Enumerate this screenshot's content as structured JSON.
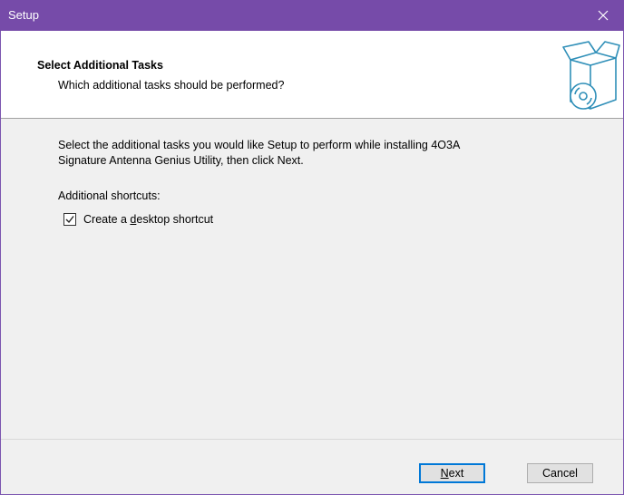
{
  "window": {
    "title": "Setup",
    "close_icon": "close-icon",
    "accent": "#764ba9"
  },
  "header": {
    "title": "Select Additional Tasks",
    "subtitle": "Which additional tasks should be performed?",
    "icon": "install-box-icon"
  },
  "content": {
    "description_line1": "Select the additional tasks you would like Setup to perform while installing 4O3A",
    "description_line2": "Signature Antenna Genius Utility, then click Next.",
    "shortcuts_label": "Additional shortcuts:",
    "desktop_shortcut": {
      "label_before": "Create a ",
      "label_accel": "d",
      "label_after": "esktop shortcut",
      "checked": true
    }
  },
  "buttons": {
    "next_accel": "N",
    "next_rest": "ext",
    "cancel": "Cancel"
  }
}
